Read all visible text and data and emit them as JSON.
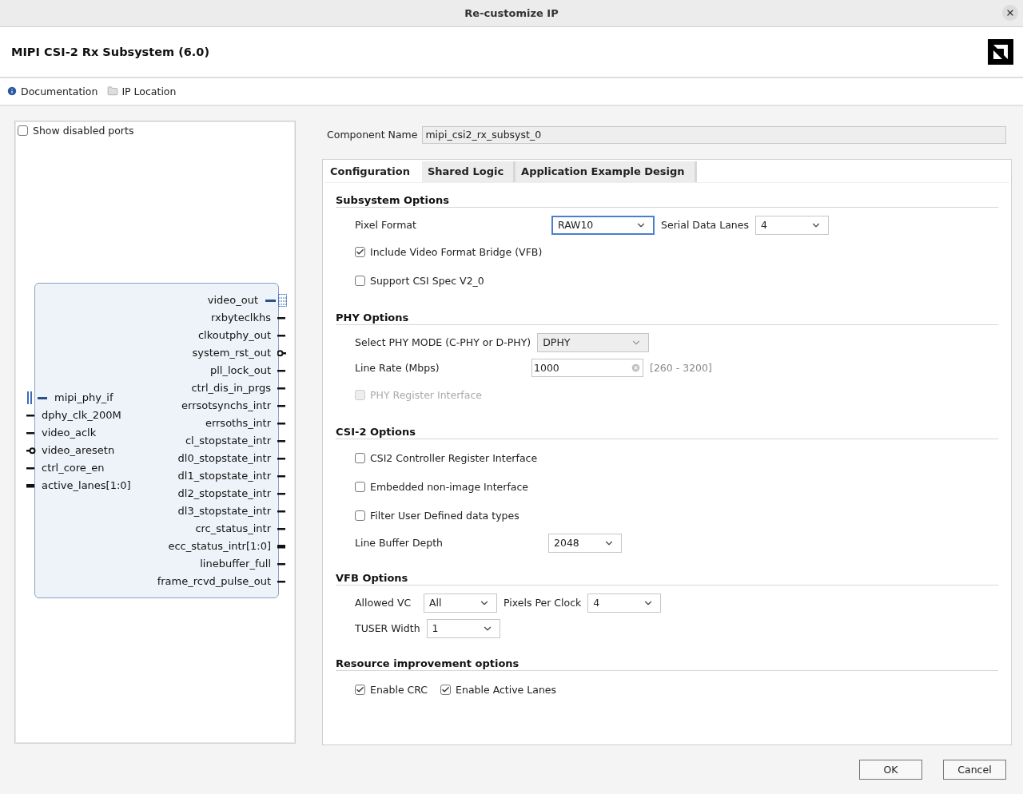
{
  "window": {
    "title": "Re-customize IP"
  },
  "header": {
    "title": "MIPI CSI-2 Rx Subsystem (6.0)"
  },
  "links": [
    {
      "kind": "info",
      "label": "Documentation"
    },
    {
      "kind": "folder",
      "label": "IP Location"
    }
  ],
  "symbol_panel": {
    "show_disabled_ports": {
      "label": "Show disabled ports",
      "checked": false
    },
    "left_ports": [
      {
        "name": "mipi_phy_if",
        "kind": "interface"
      },
      {
        "name": "dphy_clk_200M",
        "kind": "wire"
      },
      {
        "name": "video_aclk",
        "kind": "wire"
      },
      {
        "name": "video_aresetn",
        "kind": "reset"
      },
      {
        "name": "ctrl_core_en",
        "kind": "wire"
      },
      {
        "name": "active_lanes[1:0]",
        "kind": "bus"
      }
    ],
    "right_ports": [
      {
        "name": "video_out",
        "kind": "interface"
      },
      {
        "name": "rxbyteclkhs",
        "kind": "wire"
      },
      {
        "name": "clkoutphy_out",
        "kind": "wire"
      },
      {
        "name": "system_rst_out",
        "kind": "reset"
      },
      {
        "name": "pll_lock_out",
        "kind": "wire"
      },
      {
        "name": "ctrl_dis_in_prgs",
        "kind": "wire"
      },
      {
        "name": "errsotsynchs_intr",
        "kind": "wire"
      },
      {
        "name": "errsoths_intr",
        "kind": "wire"
      },
      {
        "name": "cl_stopstate_intr",
        "kind": "wire"
      },
      {
        "name": "dl0_stopstate_intr",
        "kind": "wire"
      },
      {
        "name": "dl1_stopstate_intr",
        "kind": "wire"
      },
      {
        "name": "dl2_stopstate_intr",
        "kind": "wire"
      },
      {
        "name": "dl3_stopstate_intr",
        "kind": "wire"
      },
      {
        "name": "crc_status_intr",
        "kind": "wire"
      },
      {
        "name": "ecc_status_intr[1:0]",
        "kind": "bus"
      },
      {
        "name": "linebuffer_full",
        "kind": "wire"
      },
      {
        "name": "frame_rcvd_pulse_out",
        "kind": "wire"
      }
    ]
  },
  "component_name": {
    "label": "Component Name",
    "value": "mipi_csi2_rx_subsyst_0"
  },
  "tabs": [
    {
      "label": "Configuration",
      "selected": true
    },
    {
      "label": "Shared Logic",
      "selected": false
    },
    {
      "label": "Application Example Design",
      "selected": false
    }
  ],
  "sections": [
    {
      "title": "Subsystem Options",
      "rows": [
        [
          {
            "kind": "label",
            "text": "Pixel Format"
          },
          {
            "kind": "select",
            "value": "RAW10",
            "focused": true,
            "disabled": false
          },
          {
            "kind": "label",
            "text": "Serial Data Lanes"
          },
          {
            "kind": "select",
            "value": "4",
            "focused": false,
            "disabled": false
          }
        ],
        [
          {
            "kind": "checkbox",
            "label": "Include Video Format Bridge (VFB)",
            "checked": true,
            "disabled": false
          }
        ],
        [
          {
            "kind": "checkbox",
            "label": "Support CSI Spec V2_0",
            "checked": false,
            "disabled": false
          }
        ]
      ]
    },
    {
      "title": "PHY Options",
      "rows": [
        [
          {
            "kind": "label",
            "text": "Select PHY MODE (C-PHY or D-PHY)"
          },
          {
            "kind": "select",
            "value": "DPHY",
            "focused": false,
            "disabled": true
          }
        ],
        [
          {
            "kind": "label",
            "text": "Line Rate (Mbps)"
          },
          {
            "kind": "input",
            "value": "1000"
          },
          {
            "kind": "hint",
            "text": "[260 - 3200]"
          }
        ],
        [
          {
            "kind": "checkbox",
            "label": "PHY Register Interface",
            "checked": false,
            "disabled": true
          }
        ]
      ]
    },
    {
      "title": "CSI-2 Options",
      "rows": [
        [
          {
            "kind": "checkbox",
            "label": "CSI2 Controller Register Interface",
            "checked": false,
            "disabled": false
          }
        ],
        [
          {
            "kind": "checkbox",
            "label": "Embedded non-image Interface",
            "checked": false,
            "disabled": false
          }
        ],
        [
          {
            "kind": "checkbox",
            "label": "Filter User Defined data types",
            "checked": false,
            "disabled": false
          }
        ],
        [
          {
            "kind": "label",
            "text": "Line Buffer Depth"
          },
          {
            "kind": "select",
            "value": "2048",
            "focused": false,
            "disabled": false
          }
        ]
      ]
    },
    {
      "title": "VFB Options",
      "rows": [
        [
          {
            "kind": "label",
            "text": "Allowed VC"
          },
          {
            "kind": "select",
            "value": "All",
            "focused": false,
            "disabled": false
          },
          {
            "kind": "label",
            "text": "Pixels Per Clock"
          },
          {
            "kind": "select",
            "value": "4",
            "focused": false,
            "disabled": false
          }
        ],
        [
          {
            "kind": "label",
            "text": "TUSER Width"
          },
          {
            "kind": "select",
            "value": "1",
            "focused": false,
            "disabled": false
          }
        ]
      ]
    },
    {
      "title": "Resource improvement options",
      "rows": [
        [
          {
            "kind": "checkbox",
            "label": "Enable CRC",
            "checked": true,
            "disabled": false
          },
          {
            "kind": "checkbox",
            "label": "Enable Active Lanes",
            "checked": true,
            "disabled": false
          }
        ]
      ]
    }
  ],
  "buttons": [
    {
      "label": "OK"
    },
    {
      "label": "Cancel"
    }
  ]
}
